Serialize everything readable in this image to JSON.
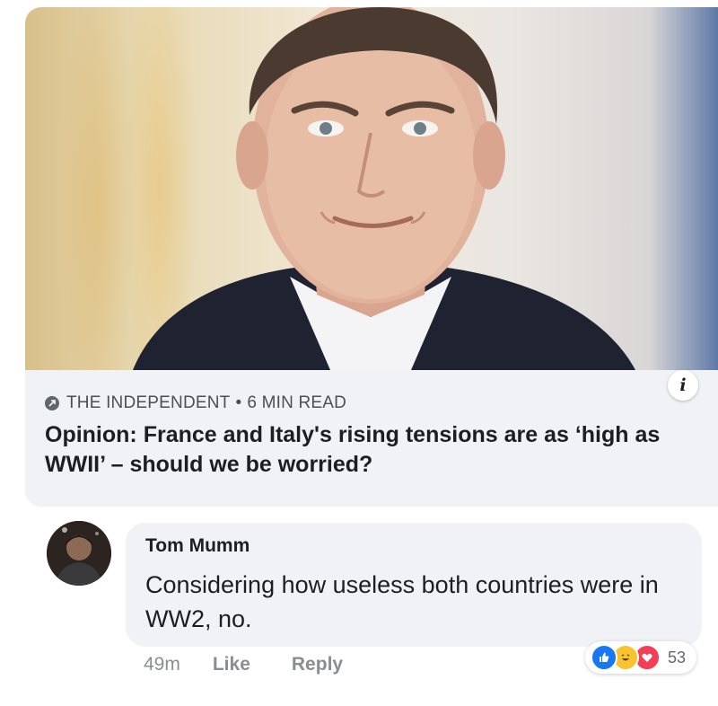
{
  "article": {
    "source": "THE INDEPENDENT",
    "separator": "•",
    "read_time": "6 MIN READ",
    "headline": "Opinion: France and Italy's rising tensions are as ‘high as WWII’ – should we be worried?",
    "info_label": "i"
  },
  "comment": {
    "author": "Tom Mumm",
    "text": "Considering how useless both countries were in WW2, no.",
    "time": "49m",
    "like_label": "Like",
    "reply_label": "Reply",
    "reaction_count": "53",
    "reactions": [
      "like-icon",
      "haha-icon",
      "love-icon"
    ]
  },
  "colors": {
    "bubble_bg": "#f0f2f5",
    "text_primary": "#1c1e21",
    "text_secondary": "#8a8d91",
    "like_blue": "#1877f2",
    "love_red": "#f33e58",
    "haha_yellow": "#f7c32f"
  }
}
